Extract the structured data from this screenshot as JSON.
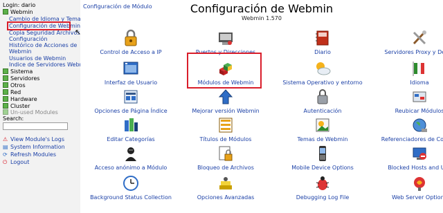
{
  "sidebar": {
    "login": "Login: dario",
    "categories": {
      "webmin": "Webmin",
      "sistema": "Sistema",
      "servidores": "Servidores",
      "otros": "Otros",
      "red": "Red",
      "hardware": "Hardware",
      "cluster": "Cluster",
      "unused": "Un-used Modules"
    },
    "webmin_items": [
      "Cambio de Idioma y Tema",
      "Configuración de Webmin",
      "Copia Seguridad Archivos Configuración",
      "Histórico de Acciones de Webmin",
      "Usuarios de Webmin",
      "Indice de Servidores Webmin"
    ],
    "webmin_items_wrapped": [
      "Copia Seguridad Archivos",
      "Configuración",
      "Histórico de Acciones de",
      "Webmin"
    ],
    "search_label": "Search:",
    "search_value": "",
    "links": {
      "view_logs": "View Module's Logs",
      "system_info": "System Information",
      "refresh": "Refresh Modules",
      "logout": "Logout"
    }
  },
  "header": {
    "breadcrumb": "Configuración de Módulo",
    "title": "Configuración de Webmin",
    "version": "Webmin 1.570"
  },
  "modules": [
    {
      "label": "Control de Acceso a IP",
      "icon": "lock-icon"
    },
    {
      "label": "Puertos y Direcciones",
      "icon": "network-card-icon"
    },
    {
      "label": "Diario",
      "icon": "notebook-icon"
    },
    {
      "label": "Servidores Proxy y Desca",
      "icon": "tools-icon"
    },
    {
      "label": "Interfaz de Usuario",
      "icon": "window-icon"
    },
    {
      "label": "Módulos de Webmin",
      "icon": "cubes-icon"
    },
    {
      "label": "Sistema Operativo y entorno",
      "icon": "weather-icon"
    },
    {
      "label": "Idioma",
      "icon": "flag-icon"
    },
    {
      "label": "Opciones de Página Índice",
      "icon": "page-options-icon"
    },
    {
      "label": "Mejorar versión Webmin",
      "icon": "upgrade-arrow-icon"
    },
    {
      "label": "Autenticación",
      "icon": "padlock-icon"
    },
    {
      "label": "Reubicar Módulos",
      "icon": "relocate-icon"
    },
    {
      "label": "Editar Categorías",
      "icon": "categories-icon"
    },
    {
      "label": "Títulos de Módulos",
      "icon": "titles-icon"
    },
    {
      "label": "Temas de Webmin",
      "icon": "themes-icon"
    },
    {
      "label": "Referenciadores de Configu",
      "icon": "globe-icon"
    },
    {
      "label": "Acceso anónimo a Módulo",
      "icon": "anonymous-icon"
    },
    {
      "label": "Bloqueo de Archivos",
      "icon": "file-lock-icon"
    },
    {
      "label": "Mobile Device Options",
      "icon": "mobile-phone-icon"
    },
    {
      "label": "Blocked Hosts and Use",
      "icon": "blocked-hosts-icon"
    },
    {
      "label": "Background Status Collection",
      "icon": "clock-icon"
    },
    {
      "label": "Opciones Avanzadas",
      "icon": "advanced-icon"
    },
    {
      "label": "Debugging Log File",
      "icon": "bug-icon"
    },
    {
      "label": "Web Server Options",
      "icon": "web-server-icon"
    }
  ],
  "colors": {
    "accent": "#d91d2a",
    "link": "#1a3fa6",
    "sidebar_bg": "#f2f2f2",
    "category_box": "#5cb04a"
  }
}
